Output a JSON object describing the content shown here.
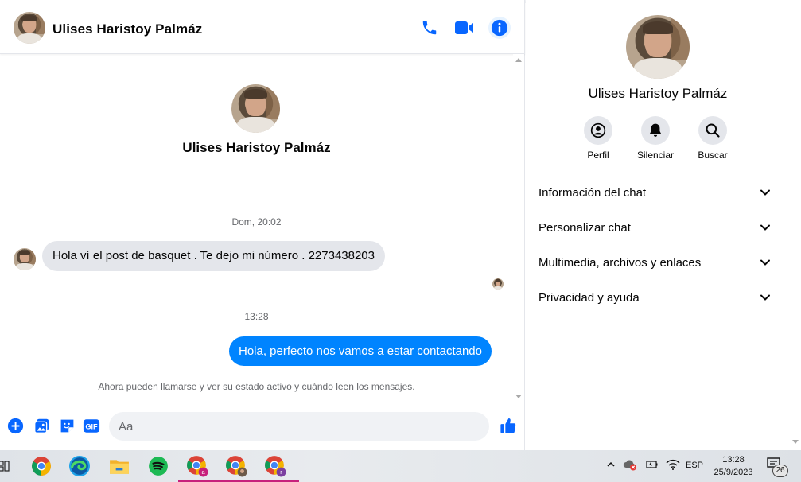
{
  "contact": {
    "name": "Ulises Haristoy Palmáz"
  },
  "conversation": {
    "timestamp_1": "Dom, 20:02",
    "incoming_message": "Hola ví el post de basquet . Te dejo mi número . 2273438203",
    "timestamp_2": "13:28",
    "outgoing_message": "Hola, perfecto nos vamos a estar contactando",
    "notice": "Ahora pueden llamarse y ver su estado activo y cuándo leen los mensajes."
  },
  "composer": {
    "placeholder": "Aa",
    "gif_label": "GIF"
  },
  "info_panel": {
    "actions": [
      {
        "label": "Perfil",
        "icon": "profile-icon"
      },
      {
        "label": "Silenciar",
        "icon": "bell-icon"
      },
      {
        "label": "Buscar",
        "icon": "search-icon"
      }
    ],
    "sections": [
      {
        "label": "Información del chat"
      },
      {
        "label": "Personalizar chat"
      },
      {
        "label": "Multimedia, archivos y enlaces"
      },
      {
        "label": "Privacidad y ayuda"
      }
    ]
  },
  "taskbar": {
    "language": "ESP",
    "time": "13:28",
    "date": "25/9/2023",
    "notification_count": "26",
    "apps": [
      {
        "name": "chrome-icon"
      },
      {
        "name": "edge-icon"
      },
      {
        "name": "file-explorer-icon"
      },
      {
        "name": "spotify-icon"
      },
      {
        "name": "chrome-profile-a-icon",
        "badge": "a"
      },
      {
        "name": "chrome-profile-photo-icon"
      },
      {
        "name": "chrome-profile-r-icon",
        "badge": "r"
      }
    ]
  },
  "colors": {
    "accent": "#0084ff",
    "messenger_blue": "#0866ff",
    "bubble_gray": "#e4e6eb",
    "taskbar_active": "#c7207c"
  }
}
